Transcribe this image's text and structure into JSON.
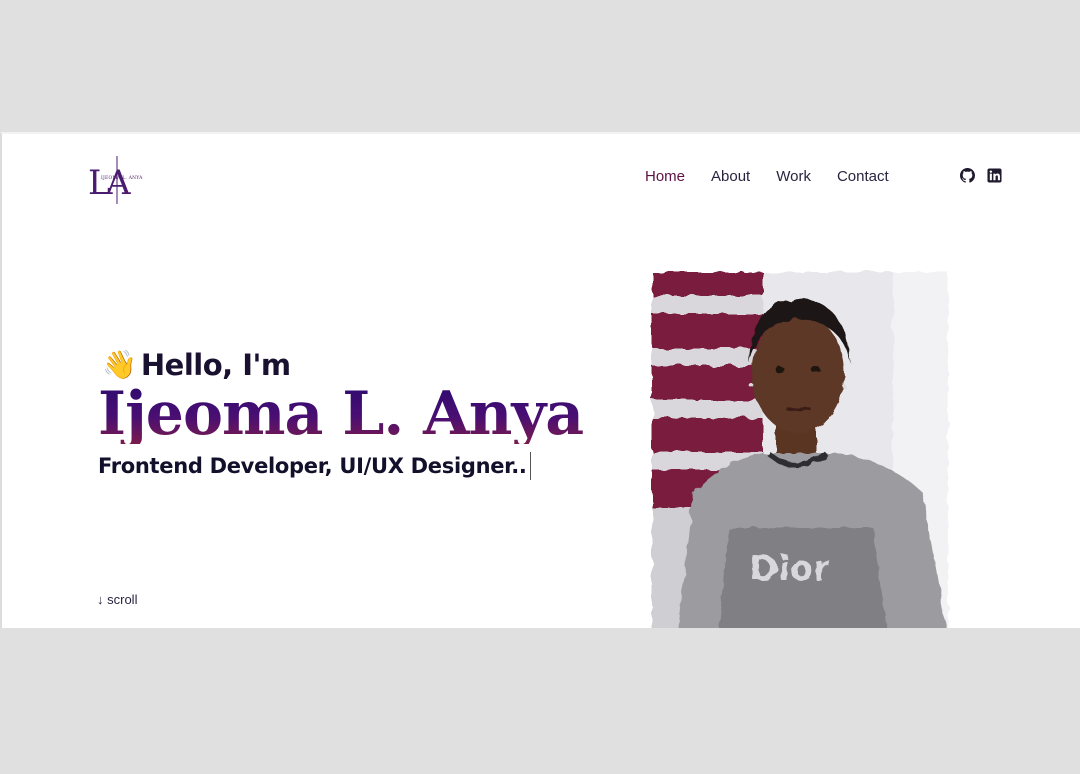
{
  "logo": {
    "monogram_left": "L",
    "monogram_right": "A",
    "tagline": "IJEOMA L. ANYA"
  },
  "nav": {
    "items": [
      {
        "label": "Home",
        "active": true
      },
      {
        "label": "About",
        "active": false
      },
      {
        "label": "Work",
        "active": false
      },
      {
        "label": "Contact",
        "active": false
      }
    ]
  },
  "socials": {
    "icons": [
      "github-icon",
      "linkedin-icon"
    ]
  },
  "hero": {
    "greeting_emoji": "👋",
    "greeting": "Hello, I'm",
    "name": "Ijeoma L. Anya",
    "role": "Frontend Developer, UI/UX Designer..",
    "scroll_label": "scroll",
    "scroll_icon": "arrow-down-icon"
  },
  "colors": {
    "background": "#e0e0e0",
    "page": "#ffffff",
    "accent_purple": "#3a0e6c",
    "accent_wine": "#5c1245",
    "text_dark": "#1a1130"
  }
}
